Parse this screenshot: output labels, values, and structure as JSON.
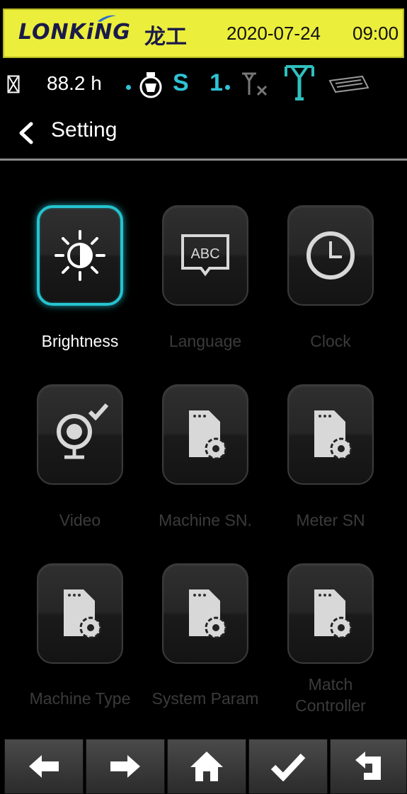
{
  "header": {
    "brand": "LONKiNG",
    "brand_cn": "龙工",
    "date": "2020-07-24",
    "time": "09:00"
  },
  "status": {
    "hours": "88.2 h",
    "gear": "S 1",
    "icons": [
      "hourglass-icon",
      "engine-icon",
      "no-signal-icon",
      "antenna-icon",
      "card-icon"
    ]
  },
  "page": {
    "title": "Setting"
  },
  "tiles": [
    {
      "label": "Brightness",
      "icon": "brightness-icon",
      "selected": true
    },
    {
      "label": "Language",
      "icon": "language-icon",
      "selected": false
    },
    {
      "label": "Clock",
      "icon": "clock-icon",
      "selected": false
    },
    {
      "label": "Video",
      "icon": "webcam-icon",
      "selected": false
    },
    {
      "label": "Machine SN.",
      "icon": "file-gear-icon",
      "selected": false
    },
    {
      "label": "Meter SN",
      "icon": "file-gear-icon",
      "selected": false
    },
    {
      "label": "Machine Type",
      "icon": "file-gear-icon",
      "selected": false
    },
    {
      "label": "System Param",
      "icon": "file-gear-icon",
      "selected": false
    },
    {
      "label": "Match Controller",
      "icon": "file-gear-icon",
      "selected": false
    }
  ],
  "nav": [
    "left-arrow-icon",
    "right-arrow-icon",
    "home-icon",
    "check-icon",
    "return-icon"
  ],
  "colors": {
    "header_bg": "#ecee3c",
    "accent": "#25c4cf",
    "disabled_label": "#3b3b3b"
  }
}
